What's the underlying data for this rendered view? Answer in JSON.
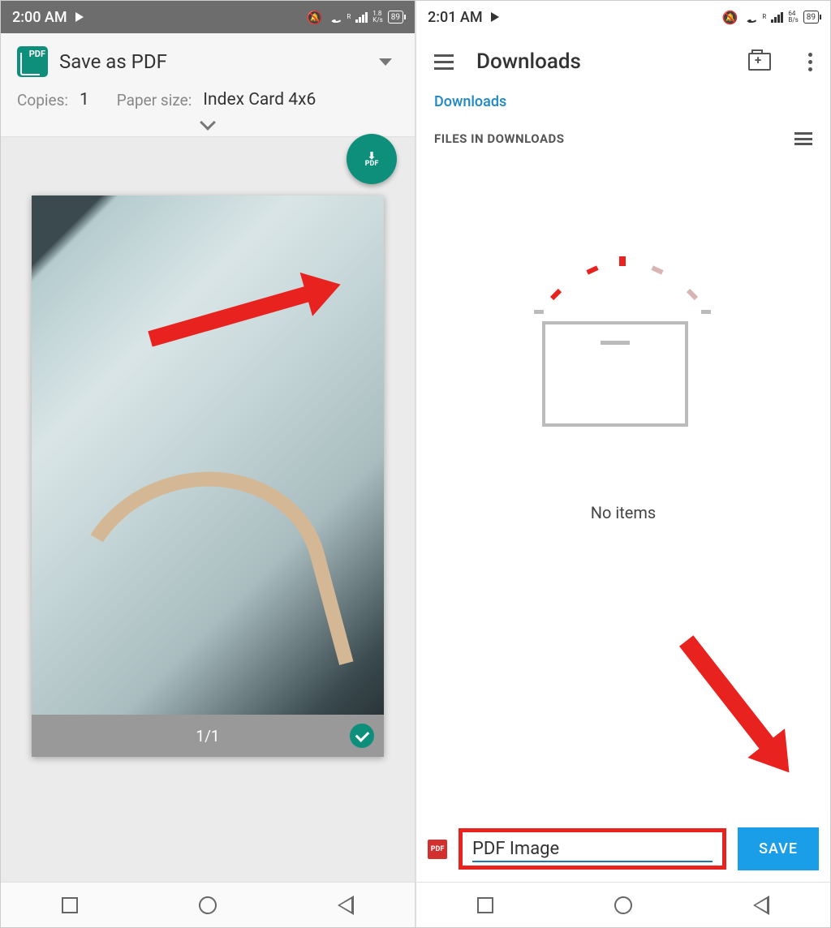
{
  "left": {
    "status": {
      "time": "2:00 AM",
      "net": "1.8",
      "net_unit": "K/s",
      "battery": "89",
      "roam": "R"
    },
    "print": {
      "title": "Save as PDF",
      "copies_label": "Copies:",
      "copies_value": "1",
      "paper_label": "Paper size:",
      "paper_value": "Index Card 4x6",
      "fab_label": "PDF",
      "page_indicator": "1/1"
    }
  },
  "right": {
    "status": {
      "time": "2:01 AM",
      "net": "64",
      "net_unit": "B/s",
      "battery": "89",
      "roam": "R"
    },
    "header": {
      "title": "Downloads"
    },
    "breadcrumb": "Downloads",
    "section": "FILES IN DOWNLOADS",
    "empty": "No items",
    "filename": "PDF Image",
    "save": "SAVE",
    "pdf_badge": "PDF"
  }
}
